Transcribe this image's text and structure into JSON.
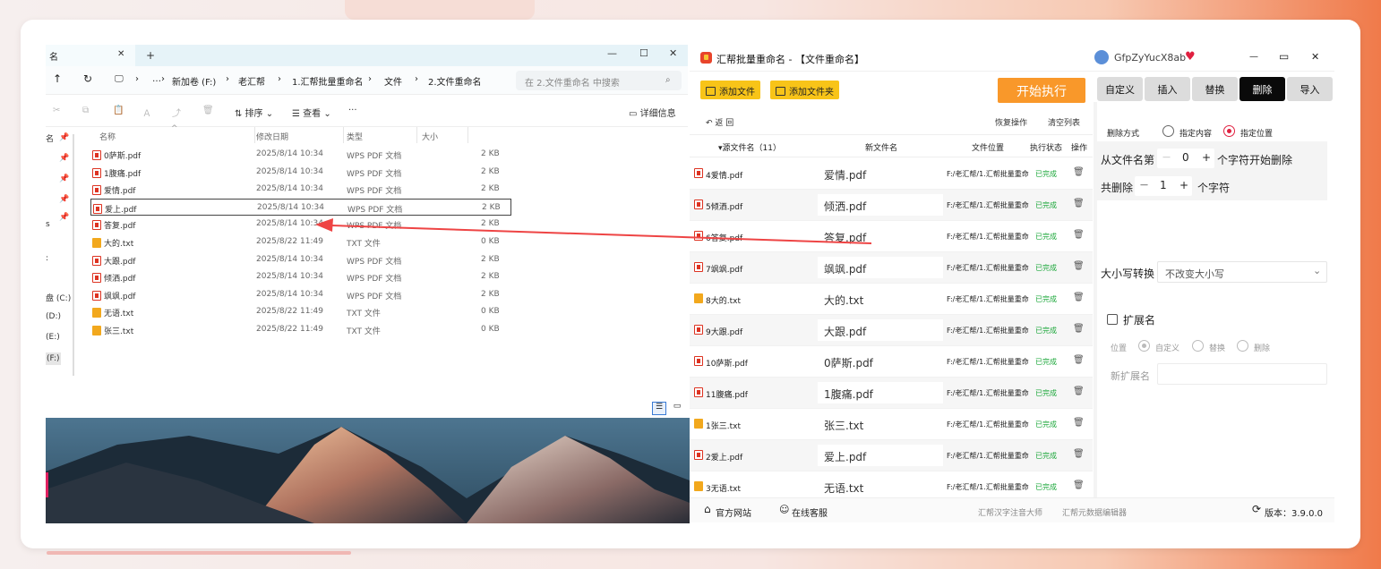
{
  "explorer": {
    "tab_fragment": "名",
    "tab_close": "✕",
    "new_tab": "+",
    "win_min": "—",
    "win_max": "☐",
    "win_close": "✕",
    "nav": {
      "up": "↑",
      "refresh": "↻",
      "monitor": "🖵",
      "more": "…",
      "sep": "›"
    },
    "breadcrumb": [
      "新加卷 (F:)",
      "老汇帮",
      "1.汇帮批量重命名",
      "文件",
      "2.文件重命名"
    ],
    "search_placeholder": "在 2.文件重命名 中搜索",
    "search_icon": "⌕",
    "toolbar": {
      "cut": "✂",
      "copy": "⧉",
      "paste": "📋",
      "rename": "Ａ",
      "share": "⤴",
      "delete": "🗑",
      "sort": "⇅ 排序 ⌄",
      "view": "☰ 查看 ⌄",
      "more": "···",
      "details": "▭ 详细信息"
    },
    "side": {
      "items": [
        "名",
        "s",
        ":",
        "盘 (C:)",
        "(D:)",
        "(E:)",
        "(F:)"
      ]
    },
    "pins": [
      "📌",
      "📌",
      "📌",
      "📌",
      "📌"
    ],
    "columns": {
      "name": "名称",
      "date": "修改日期",
      "type": "类型",
      "size": "大小",
      "sort_glyph": "^"
    },
    "files": [
      {
        "name": "0萨斯.pdf",
        "date": "2025/8/14 10:34",
        "type": "WPS PDF 文档",
        "size": "2 KB",
        "icon": "pdf"
      },
      {
        "name": "1腹痛.pdf",
        "date": "2025/8/14 10:34",
        "type": "WPS PDF 文档",
        "size": "2 KB",
        "icon": "pdf"
      },
      {
        "name": "爱情.pdf",
        "date": "2025/8/14 10:34",
        "type": "WPS PDF 文档",
        "size": "2 KB",
        "icon": "pdf"
      },
      {
        "name": "爱上.pdf",
        "date": "2025/8/14 10:34",
        "type": "WPS PDF 文档",
        "size": "2 KB",
        "icon": "pdf",
        "selected": true
      },
      {
        "name": "答复.pdf",
        "date": "2025/8/14 10:34",
        "type": "WPS PDF 文档",
        "size": "2 KB",
        "icon": "pdf"
      },
      {
        "name": "大的.txt",
        "date": "2025/8/22 11:49",
        "type": "TXT 文件",
        "size": "0 KB",
        "icon": "txt"
      },
      {
        "name": "大跟.pdf",
        "date": "2025/8/14 10:34",
        "type": "WPS PDF 文档",
        "size": "2 KB",
        "icon": "pdf"
      },
      {
        "name": "倾洒.pdf",
        "date": "2025/8/14 10:34",
        "type": "WPS PDF 文档",
        "size": "2 KB",
        "icon": "pdf"
      },
      {
        "name": "飒飒.pdf",
        "date": "2025/8/14 10:34",
        "type": "WPS PDF 文档",
        "size": "2 KB",
        "icon": "pdf"
      },
      {
        "name": "无语.txt",
        "date": "2025/8/22 11:49",
        "type": "TXT 文件",
        "size": "0 KB",
        "icon": "txt"
      },
      {
        "name": "张三.txt",
        "date": "2025/8/22 11:49",
        "type": "TXT 文件",
        "size": "0 KB",
        "icon": "txt"
      }
    ],
    "status": {
      "list_view": "☰",
      "tile_view": "▭"
    }
  },
  "app": {
    "title": "汇帮批量重命名 - 【文件重命名】",
    "user": "GfpZyYucX8ab",
    "heart": "♥",
    "win_min": "—",
    "win_max": "▭",
    "win_close": "✕",
    "add_file": "添加文件",
    "add_folder": "添加文件夹",
    "start": "开始执行",
    "tabs": [
      "自定义",
      "插入",
      "替换",
      "删除",
      "导入"
    ],
    "active_tab": "删除",
    "back": "↶ 返  回",
    "restore": "恢复操作",
    "clear": "清空列表",
    "grid": {
      "col_orig": "▾源文件名（11）",
      "col_new": "新文件名",
      "col_path": "文件位置",
      "col_status": "执行状态",
      "col_op": "操作"
    },
    "rows": [
      {
        "orig": "4爱情.pdf",
        "new": "爱情.pdf",
        "path": "F:/老汇帮/1.汇帮批量重命",
        "status": "已完成",
        "icon": "pdf"
      },
      {
        "orig": "5倾洒.pdf",
        "new": "倾洒.pdf",
        "path": "F:/老汇帮/1.汇帮批量重命",
        "status": "已完成",
        "icon": "pdf"
      },
      {
        "orig": "6答复.pdf",
        "new": "答复.pdf",
        "path": "F:/老汇帮/1.汇帮批量重命",
        "status": "已完成",
        "icon": "pdf"
      },
      {
        "orig": "7飒飒.pdf",
        "new": "飒飒.pdf",
        "path": "F:/老汇帮/1.汇帮批量重命",
        "status": "已完成",
        "icon": "pdf"
      },
      {
        "orig": "8大的.txt",
        "new": "大的.txt",
        "path": "F:/老汇帮/1.汇帮批量重命",
        "status": "已完成",
        "icon": "txt"
      },
      {
        "orig": "9大跟.pdf",
        "new": "大跟.pdf",
        "path": "F:/老汇帮/1.汇帮批量重命",
        "status": "已完成",
        "icon": "pdf"
      },
      {
        "orig": "10萨斯.pdf",
        "new": "0萨斯.pdf",
        "path": "F:/老汇帮/1.汇帮批量重命",
        "status": "已完成",
        "icon": "pdf"
      },
      {
        "orig": "11腹痛.pdf",
        "new": "1腹痛.pdf",
        "path": "F:/老汇帮/1.汇帮批量重命",
        "status": "已完成",
        "icon": "pdf"
      },
      {
        "orig": "1张三.txt",
        "new": "张三.txt",
        "path": "F:/老汇帮/1.汇帮批量重命",
        "status": "已完成",
        "icon": "txt"
      },
      {
        "orig": "2爱上.pdf",
        "new": "爱上.pdf",
        "path": "F:/老汇帮/1.汇帮批量重命",
        "status": "已完成",
        "icon": "pdf"
      },
      {
        "orig": "3无语.txt",
        "new": "无语.txt",
        "path": "F:/老汇帮/1.汇帮批量重命",
        "status": "已完成",
        "icon": "txt"
      }
    ],
    "trash_icon": "🗑",
    "panel": {
      "delete_mode_label": "删除方式",
      "opt_content": "指定内容",
      "opt_position": "指定位置",
      "from_label": "从文件名第",
      "from_value": "0",
      "from_suffix": "个字符开始删除",
      "count_label": "共删除",
      "count_value": "1",
      "count_suffix": "个字符",
      "minus": "—",
      "plus": "+",
      "case_label": "大小写转换",
      "case_value": "不改变大小写",
      "chevron": "⌄",
      "ext_label": "扩展名",
      "pos_label": "位置",
      "pos_custom": "自定义",
      "pos_replace": "替换",
      "pos_delete": "删除",
      "new_ext_label": "新扩展名"
    },
    "footer": {
      "website": "官方网站",
      "support": "在线客服",
      "link1": "汇帮汉字注音大师",
      "link2": "汇帮元数据编辑器",
      "version": "版本：3.9.0.0",
      "home_icon": "⌂",
      "support_icon": "☺",
      "refresh_icon": "⟳"
    }
  },
  "colors": {
    "accent_yellow": "#f8c418",
    "start_orange": "#f9982a",
    "done_green": "#1ea83c",
    "radio_red": "#e02040",
    "arrow_red": "#ee4444"
  }
}
